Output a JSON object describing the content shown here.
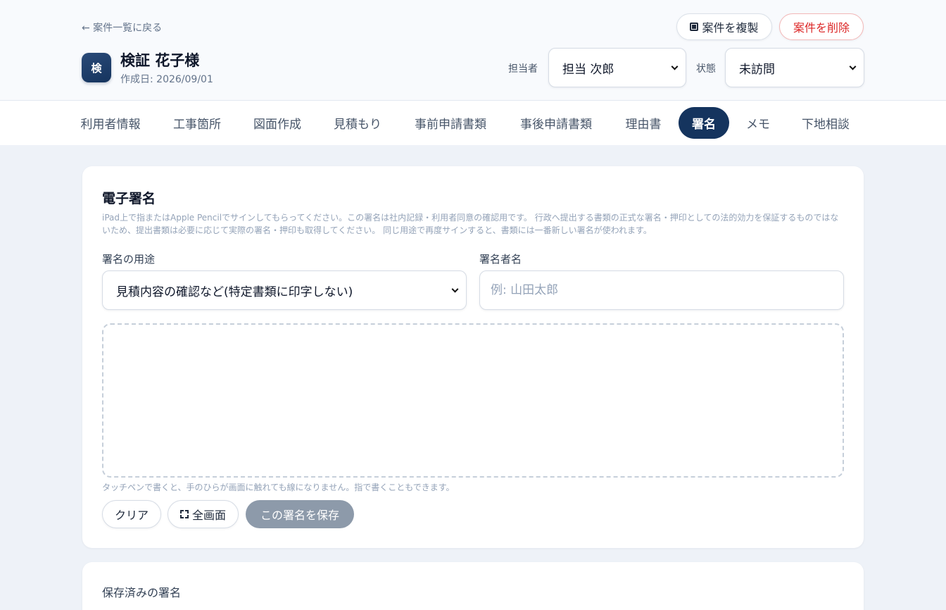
{
  "header": {
    "back_link": "← 案件一覧に戻る",
    "avatar_char": "検",
    "client_name": "検証 花子様",
    "created_label": "作成日: 2026/09/01",
    "duplicate_label": "案件を複製",
    "delete_label": "案件を削除",
    "assignee_label": "担当者",
    "assignee_value": "担当 次郎",
    "status_label": "状態",
    "status_value": "未訪問"
  },
  "tabs": [
    {
      "label": "利用者情報",
      "active": false
    },
    {
      "label": "工事箇所",
      "active": false
    },
    {
      "label": "図面作成",
      "active": false
    },
    {
      "label": "見積もり",
      "active": false
    },
    {
      "label": "事前申請書類",
      "active": false
    },
    {
      "label": "事後申請書類",
      "active": false
    },
    {
      "label": "理由書",
      "active": false
    },
    {
      "label": "署名",
      "active": true
    },
    {
      "label": "メモ",
      "active": false
    },
    {
      "label": "下地相談",
      "active": false
    }
  ],
  "signature": {
    "title": "電子署名",
    "description": "iPad上で指またはApple Pencilでサインしてもらってください。この署名は社内記録・利用者同意の確認用です。 行政へ提出する書類の正式な署名・押印としての法的効力を保証するものではないため、提出書類は必要に応じて実際の署名・押印も取得してください。 同じ用途で再度サインすると、書類には一番新しい署名が使われます。",
    "purpose_label": "署名の用途",
    "purpose_value": "見積内容の確認など(特定書類に印字しない)",
    "signer_label": "署名者名",
    "signer_placeholder": "例: 山田太郎",
    "pad_hint": "タッチペンで書くと、手のひらが画面に触れても線になりません。指で書くこともできます。",
    "clear_label": "クリア",
    "fullscreen_label": "全画面",
    "save_label": "この署名を保存"
  },
  "saved": {
    "title": "保存済みの署名"
  },
  "colors": {
    "primary": "#15345e",
    "danger": "#dc2626",
    "disabled": "#8d9aaa",
    "background": "#eef2f8"
  }
}
